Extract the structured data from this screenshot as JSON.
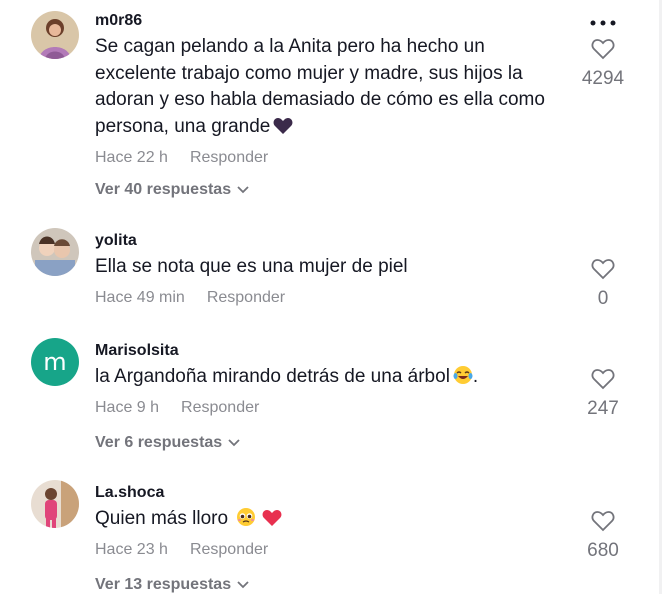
{
  "comments": [
    {
      "username": "m0r86",
      "text": "Se cagan pelando a la Anita pero ha hecho un excelente trabajo como mujer y madre, sus hijos la adoran y eso habla demasiado de cómo es ella como persona, una grande",
      "emoji": "black-heart",
      "time": "Hace 22 h",
      "reply_label": "Responder",
      "likes": "4294",
      "replies_label": "Ver 40 respuestas",
      "avatar": "photo"
    },
    {
      "username": "yolita",
      "text": "Ella se nota que es una mujer de piel",
      "time": "Hace 49 min",
      "reply_label": "Responder",
      "likes": "0",
      "avatar": "photo"
    },
    {
      "username": "Marisolsita",
      "text": "la Argandoña mirando detrás de una árbol",
      "text_suffix": ".",
      "emoji": "laughing-tears",
      "time": "Hace 9 h",
      "reply_label": "Responder",
      "likes": "247",
      "replies_label": "Ver 6 respuestas",
      "avatar_initial": "m"
    },
    {
      "username": "La.shoca",
      "text": "Quien más lloro",
      "emoji": "pleading-face red-heart",
      "time": "Hace 23 h",
      "reply_label": "Responder",
      "likes": "680",
      "replies_label": "Ver 13 respuestas",
      "avatar": "photo"
    }
  ],
  "colors": {
    "text": "#161823",
    "muted": "#8a8b91",
    "replies": "#73747b",
    "avatar_m": "#17a589"
  }
}
